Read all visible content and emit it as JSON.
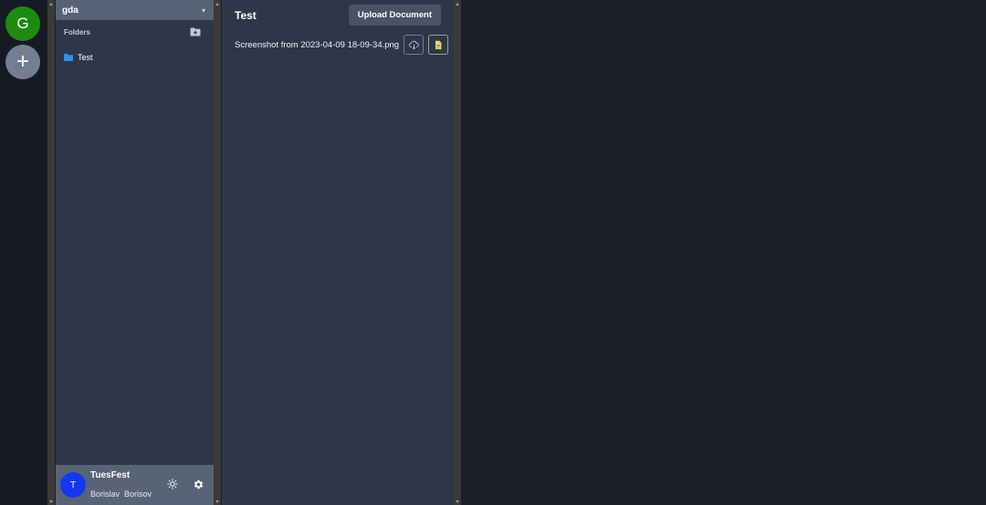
{
  "servers": [
    {
      "letter": "G",
      "color": "#1f8a12"
    },
    {
      "letter": "+",
      "color": "#737e94"
    }
  ],
  "sidebar": {
    "workspace_name": "gda",
    "chevron": "chevron-down-icon",
    "folders_label": "Folders",
    "add_folder_icon": "folder-plus-icon",
    "folders": [
      {
        "name": "Test",
        "icon": "folder-icon",
        "color": "#2f8fe8"
      }
    ]
  },
  "user": {
    "initial": "T",
    "username": "TuesFest",
    "full_name": "Borislav  Borisov",
    "theme_icon": "sun-icon",
    "settings_icon": "gear-icon"
  },
  "main": {
    "title": "Test",
    "upload_label": "Upload Document",
    "files": [
      {
        "name": "Screenshot from 2023-04-09 18-09-34.png",
        "download_icon": "cloud-download-icon",
        "open_icon": "document-icon"
      }
    ]
  },
  "colors": {
    "background": "#1c202b",
    "panel": "#2e3748",
    "header": "#566275",
    "avatar": "#1438f2"
  }
}
